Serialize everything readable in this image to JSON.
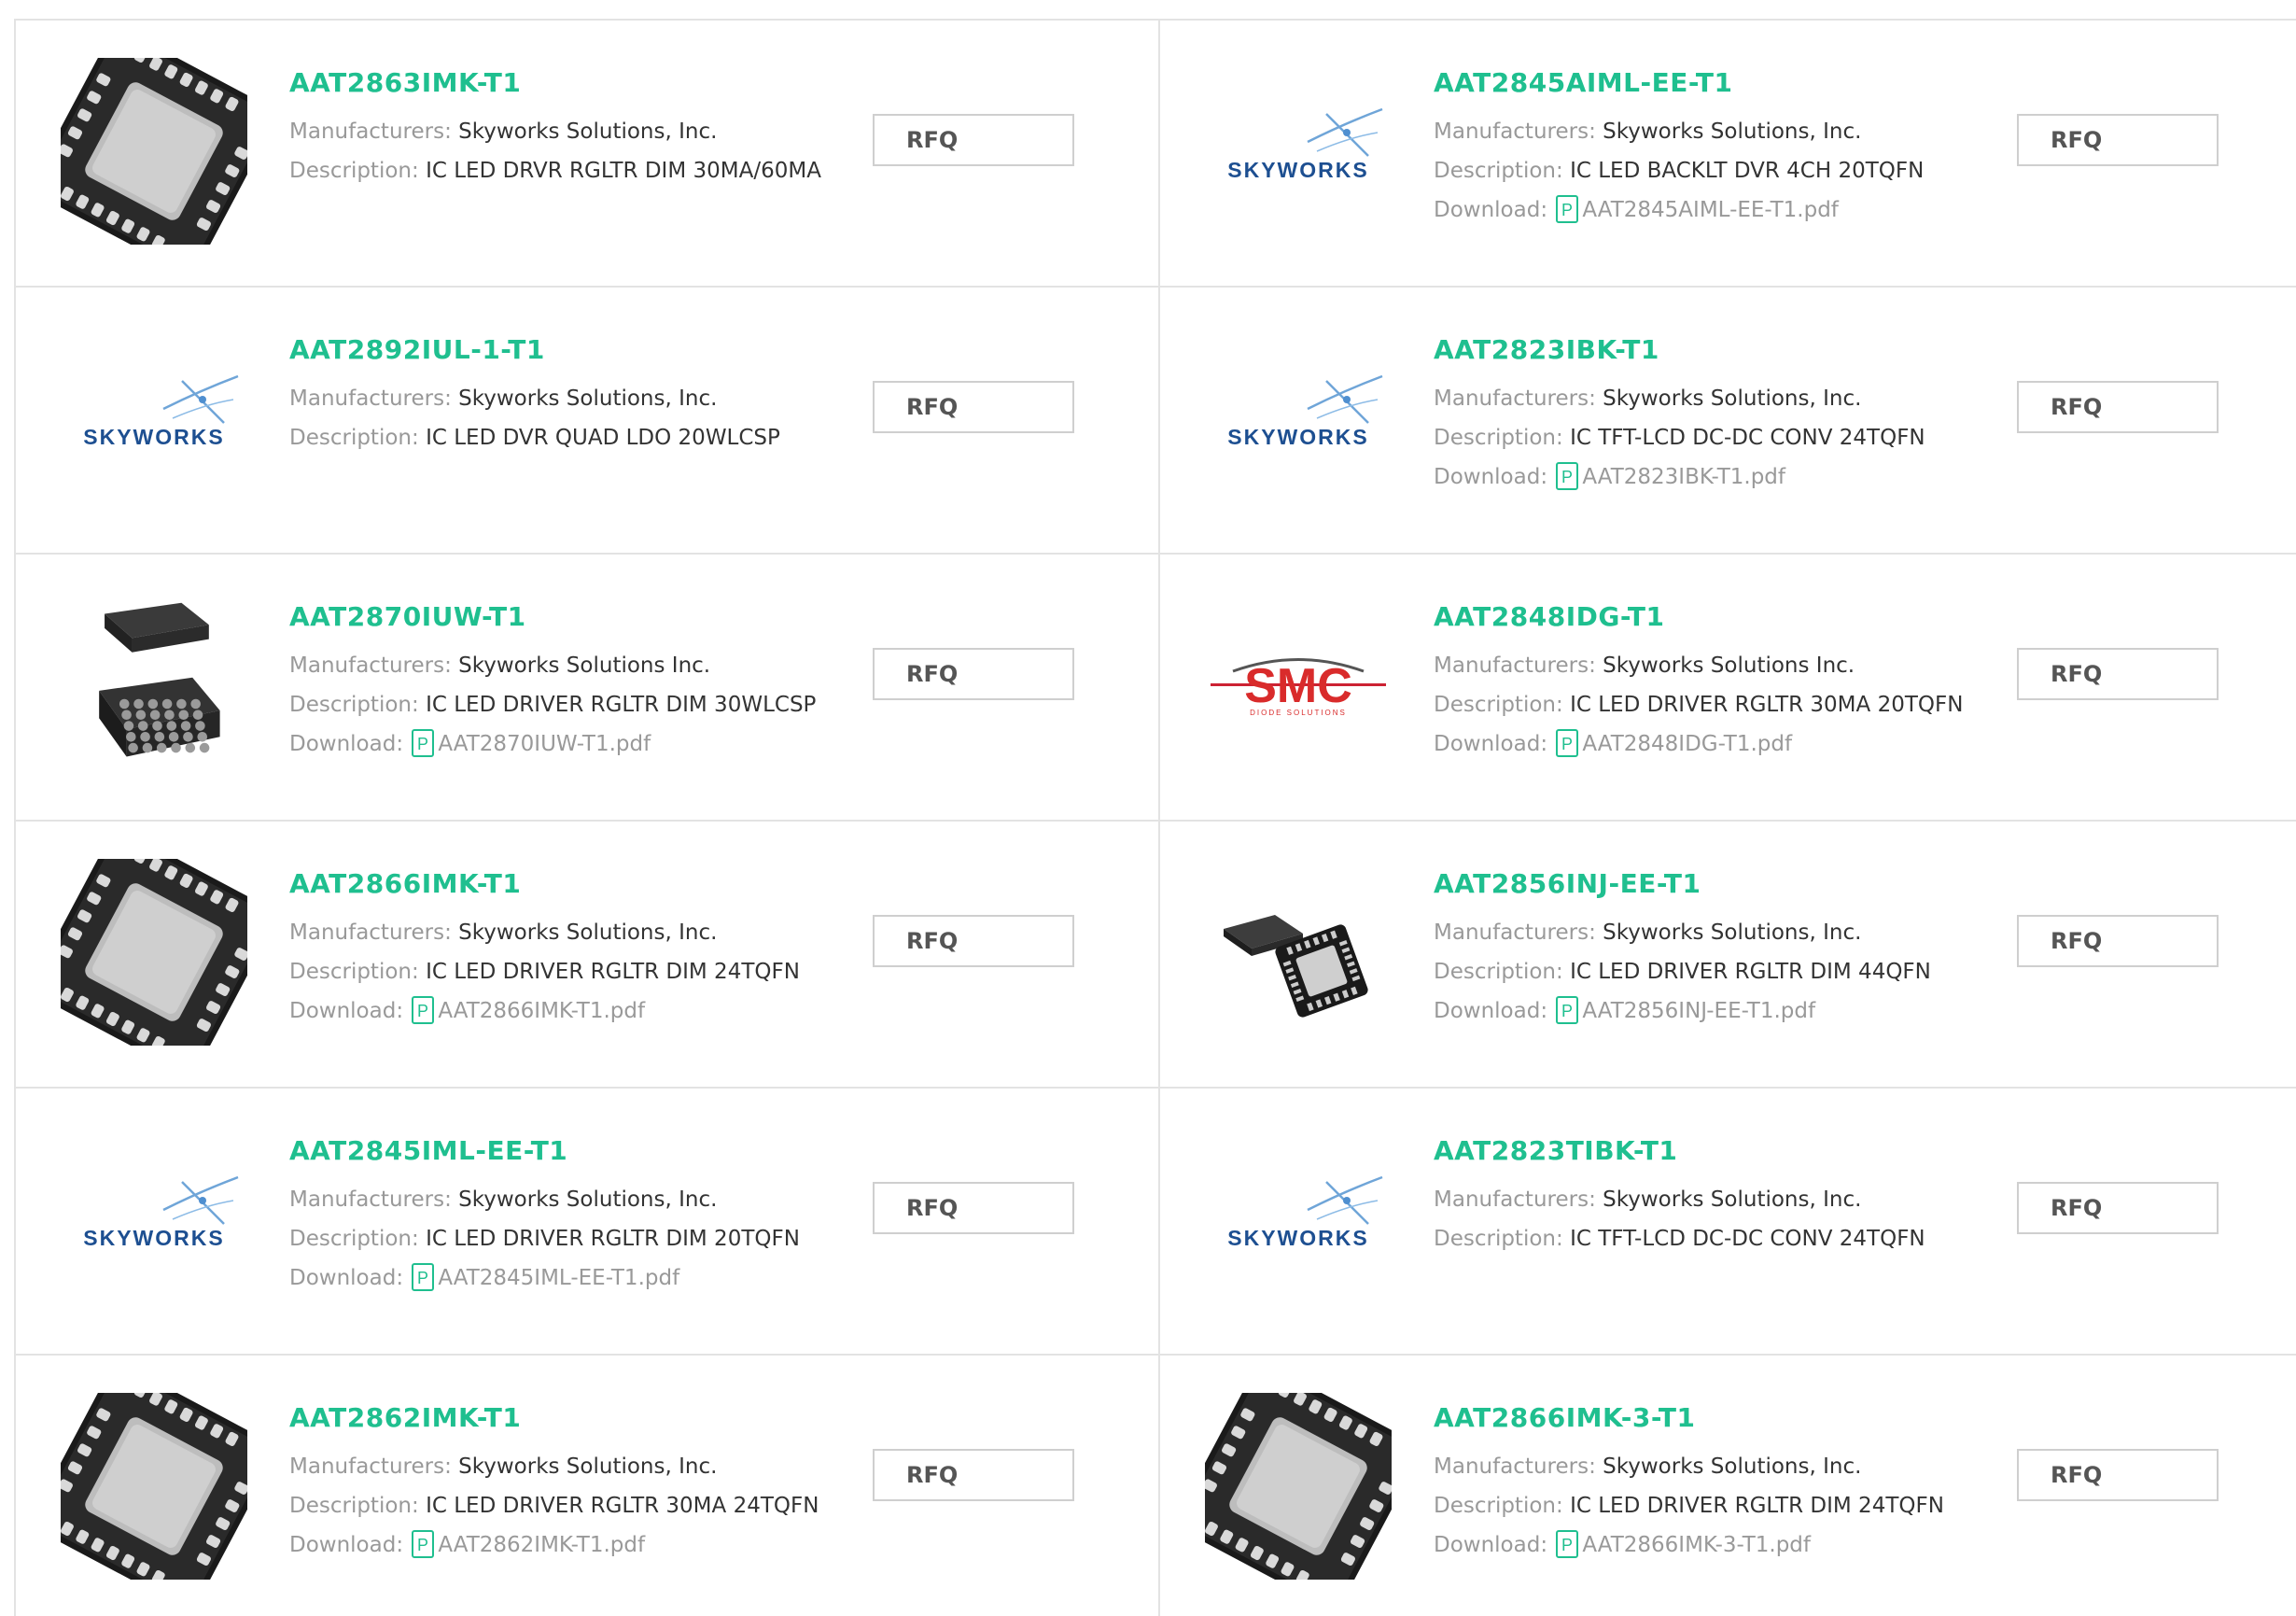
{
  "labels": {
    "manufacturers": "Manufacturers:",
    "description": "Description:",
    "download": "Download:",
    "rfq": "RFQ"
  },
  "colors": {
    "accent": "#1fbf8f",
    "border": "#e3e3e3",
    "skyworks_blue": "#1d4f91",
    "smc_red": "#d92b2b"
  },
  "products": [
    {
      "part": "AAT2863IMK-T1",
      "manufacturer": "Skyworks Solutions, Inc.",
      "description": "IC LED DRVR RGLTR DIM 30MA/60MA",
      "download": null,
      "image": "qfn-chip-top"
    },
    {
      "part": "AAT2845AIML-EE-T1",
      "manufacturer": "Skyworks Solutions, Inc.",
      "description": "IC LED BACKLT DVR 4CH 20TQFN",
      "download": "AAT2845AIML-EE-T1.pdf",
      "image": "skyworks-logo"
    },
    {
      "part": "AAT2892IUL-1-T1",
      "manufacturer": "Skyworks Solutions, Inc.",
      "description": "IC LED DVR QUAD LDO 20WLCSP",
      "download": null,
      "image": "skyworks-logo"
    },
    {
      "part": "AAT2823IBK-T1",
      "manufacturer": "Skyworks Solutions, Inc.",
      "description": "IC TFT-LCD DC-DC CONV 24TQFN",
      "download": "AAT2823IBK-T1.pdf",
      "image": "skyworks-logo"
    },
    {
      "part": "AAT2870IUW-T1",
      "manufacturer": "Skyworks Solutions Inc.",
      "description": "IC LED DRIVER RGLTR DIM 30WLCSP",
      "download": "AAT2870IUW-T1.pdf",
      "image": "wlcsp-chip"
    },
    {
      "part": "AAT2848IDG-T1",
      "manufacturer": "Skyworks Solutions Inc.",
      "description": "IC LED DRIVER RGLTR 30MA 20TQFN",
      "download": "AAT2848IDG-T1.pdf",
      "image": "smc-logo"
    },
    {
      "part": "AAT2866IMK-T1",
      "manufacturer": "Skyworks Solutions, Inc.",
      "description": "IC LED DRIVER RGLTR DIM 24TQFN",
      "download": "AAT2866IMK-T1.pdf",
      "image": "qfn-chip-top"
    },
    {
      "part": "AAT2856INJ-EE-T1",
      "manufacturer": "Skyworks Solutions, Inc.",
      "description": "IC LED DRIVER RGLTR DIM 44QFN",
      "download": "AAT2856INJ-EE-T1.pdf",
      "image": "qfn-pair"
    },
    {
      "part": "AAT2845IML-EE-T1",
      "manufacturer": "Skyworks Solutions, Inc.",
      "description": "IC LED DRIVER RGLTR DIM 20TQFN",
      "download": "AAT2845IML-EE-T1.pdf",
      "image": "skyworks-logo"
    },
    {
      "part": "AAT2823TIBK-T1",
      "manufacturer": "Skyworks Solutions, Inc.",
      "description": "IC TFT-LCD DC-DC CONV 24TQFN",
      "download": null,
      "image": "skyworks-logo"
    },
    {
      "part": "AAT2862IMK-T1",
      "manufacturer": "Skyworks Solutions, Inc.",
      "description": "IC LED DRIVER RGLTR 30MA 24TQFN",
      "download": "AAT2862IMK-T1.pdf",
      "image": "qfn-chip-top"
    },
    {
      "part": "AAT2866IMK-3-T1",
      "manufacturer": "Skyworks Solutions, Inc.",
      "description": "IC LED DRIVER RGLTR DIM 24TQFN",
      "download": "AAT2866IMK-3-T1.pdf",
      "image": "qfn-chip-top"
    }
  ],
  "logos": {
    "skyworks": "SKYWORKS",
    "smc": "SMC",
    "smc_sub": "DIODE SOLUTIONS"
  }
}
